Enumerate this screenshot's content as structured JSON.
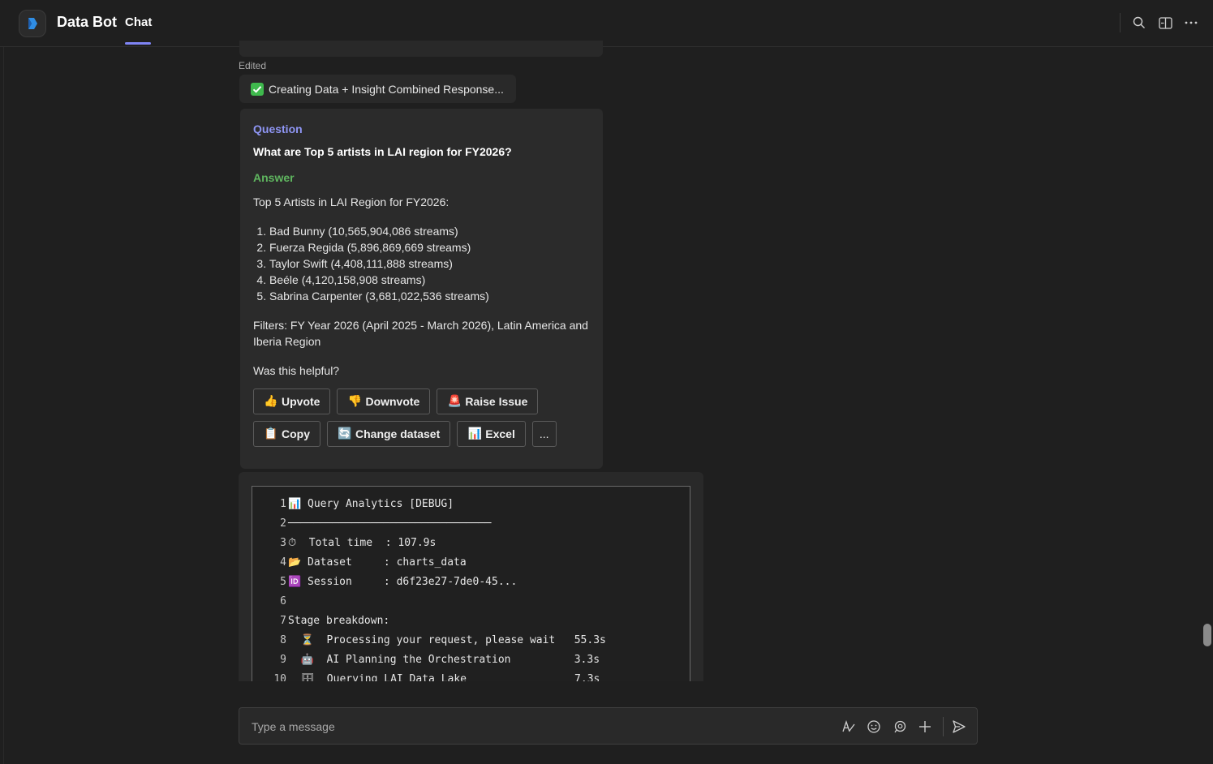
{
  "header": {
    "app_title": "Data Bot",
    "active_tab": "Chat",
    "accent_color": "#7f85f5",
    "icons": [
      "search-icon",
      "popout-icon",
      "more-icon"
    ]
  },
  "messages": {
    "edited_label": "Edited",
    "status_text": "Creating Data + Insight Combined Response...",
    "card": {
      "question_label": "Question",
      "question_text": "What are Top 5 artists in LAI region for FY2026?",
      "answer_label": "Answer",
      "answer_title": "Top 5 Artists in LAI Region for FY2026:",
      "artists": [
        "Bad Bunny (10,565,904,086 streams)",
        "Fuerza Regida (5,896,869,669 streams)",
        "Taylor Swift (4,408,111,888 streams)",
        "Beéle (4,120,158,908 streams)",
        "Sabrina Carpenter (3,681,022,536 streams)"
      ],
      "filters": "Filters: FY Year 2026 (April 2025 - March 2026), Latin America and Iberia Region",
      "helpful_prompt": "Was this helpful?",
      "buttons": {
        "upvote": "Upvote",
        "downvote": "Downvote",
        "raise_issue": "Raise Issue",
        "copy": "Copy",
        "change_dataset": "Change dataset",
        "excel": "Excel",
        "more": "..."
      },
      "question_color": "#8f96f5",
      "answer_color": "#5fb65f"
    },
    "debug": {
      "lines": [
        {
          "n": "1",
          "text": "📊 Query Analytics [DEBUG]"
        },
        {
          "n": "2",
          "text": "────────────────────────────────"
        },
        {
          "n": "3",
          "text": "⏱  Total time  : 107.9s"
        },
        {
          "n": "4",
          "text": "📂 Dataset     : charts_data"
        },
        {
          "n": "5",
          "text": "🆔 Session     : d6f23e27-7de0-45..."
        },
        {
          "n": "6",
          "text": ""
        },
        {
          "n": "7",
          "text": "Stage breakdown:"
        },
        {
          "n": "8",
          "text": "  ⏳  Processing your request, please wait   55.3s"
        },
        {
          "n": "9",
          "text": "  🤖  AI Planning the Orchestration          3.3s"
        },
        {
          "n": "10",
          "text": "  🗄  Querying LAI Data Lake                 7.3s"
        }
      ]
    }
  },
  "composer": {
    "placeholder": "Type a message"
  }
}
